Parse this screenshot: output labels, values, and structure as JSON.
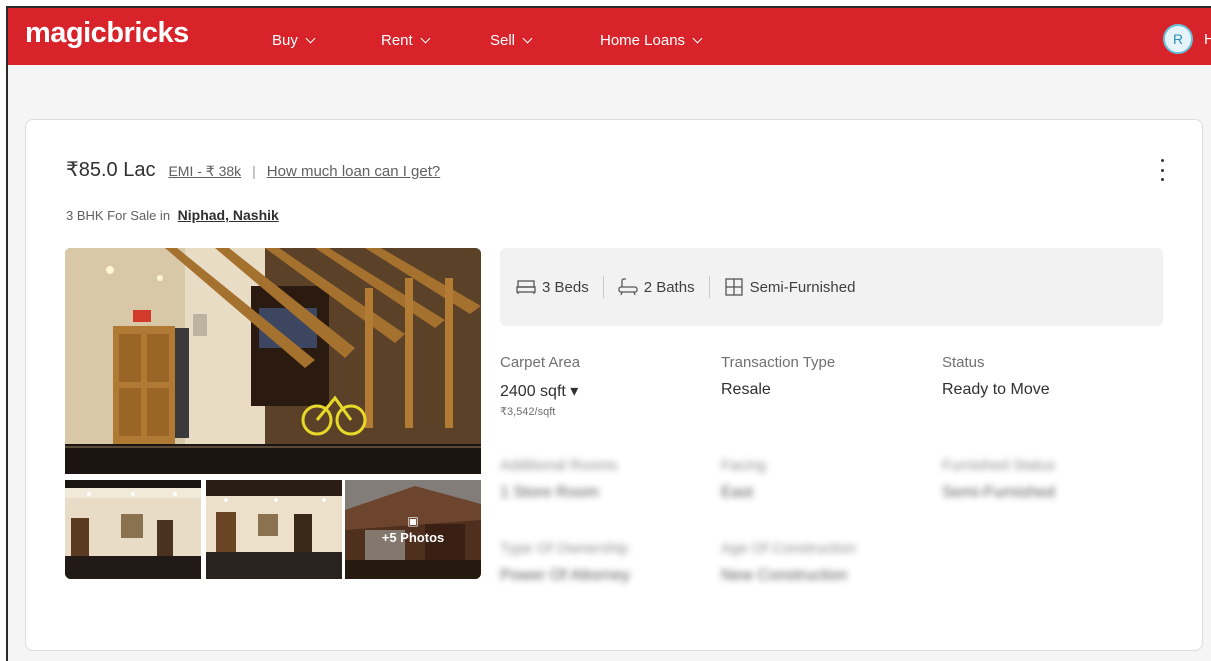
{
  "header": {
    "logo": "magicbricks",
    "nav": [
      "Buy",
      "Rent",
      "Sell",
      "Home Loans"
    ],
    "avatar_initial": "R",
    "avatar_suffix": "H"
  },
  "listing": {
    "price": "₹85.0 Lac",
    "emi": "EMI - ₹ 38k",
    "separator": "|",
    "loan_link": "How much loan can I get?",
    "subtitle_prefix": "3 BHK For Sale in",
    "location": "Niphad, Nashik",
    "photos_more": "+5 Photos",
    "summary": [
      {
        "icon": "bed-icon",
        "label": "3 Beds"
      },
      {
        "icon": "bath-icon",
        "label": "2 Baths"
      },
      {
        "icon": "furnishing-icon",
        "label": "Semi-Furnished"
      }
    ],
    "attributes": [
      {
        "label": "Carpet Area",
        "value": "2400 sqft",
        "sub": "₹3,542/sqft"
      },
      {
        "label": "Transaction Type",
        "value": "Resale"
      },
      {
        "label": "Status",
        "value": "Ready to Move"
      },
      {
        "label": "Additional Rooms",
        "value": "1 Store Room"
      },
      {
        "label": "Facing",
        "value": "East"
      },
      {
        "label": "Furnished Status",
        "value": "Semi-Furnished"
      },
      {
        "label": "Type Of Ownership",
        "value": "Power Of Attorney"
      },
      {
        "label": "Age Of Construction",
        "value": "New Construction"
      }
    ]
  }
}
